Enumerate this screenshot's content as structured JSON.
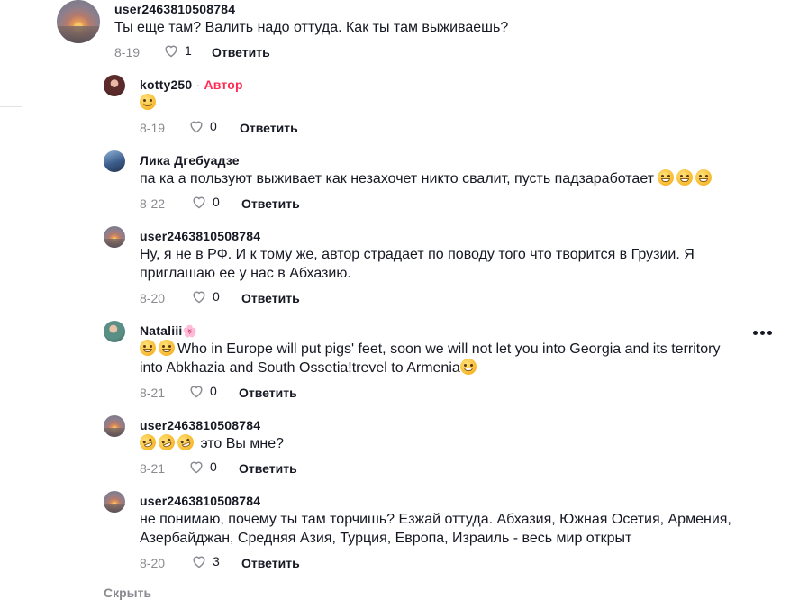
{
  "comments": [
    {
      "username": "user2463810508784",
      "text": "Ты еще там? Валить надо оттуда. Как ты там выживаешь?",
      "date": "8-19",
      "likes": "1",
      "reply_label": "Ответить",
      "avatar": "sunset"
    },
    {
      "username": "kotty250",
      "separator": "·",
      "badge": "Автор",
      "emoji": [
        "slightly-smiling-face"
      ],
      "text": "",
      "date": "8-19",
      "likes": "0",
      "reply_label": "Ответить",
      "avatar": "girl"
    },
    {
      "username": "Лика Дгебуадзе",
      "text": "па ка а пользуют выживает как незахочет никто свалит, пусть падзаработает",
      "emoji_after": [
        "grinning-face",
        "grinning-face",
        "grinning-face"
      ],
      "date": "8-22",
      "likes": "0",
      "reply_label": "Ответить",
      "avatar": "blue"
    },
    {
      "username": "user2463810508784",
      "text": "Ну, я не в РФ. И к тому же, автор страдает по поводу того что творится в Грузии. Я приглашаю ее у нас в Абхазию.",
      "date": "8-20",
      "likes": "0",
      "reply_label": "Ответить",
      "avatar": "sunset"
    },
    {
      "username": "Nataliii",
      "username_emoji": "🌸",
      "emoji_before": [
        "grinning-face",
        "grinning-face"
      ],
      "text": "Who in Europe will put pigs' feet, soon we will not let you into Georgia and its territory into Abkhazia and South Ossetia!trevel to Armenia",
      "emoji_after": [
        "face-with-tears-of-joy"
      ],
      "date": "8-21",
      "likes": "0",
      "reply_label": "Ответить",
      "avatar": "green"
    },
    {
      "username": "user2463810508784",
      "emoji_before": [
        "rolling-on-floor-laughing",
        "rolling-on-floor-laughing",
        "rolling-on-floor-laughing"
      ],
      "text": "это Вы мне?",
      "date": "8-21",
      "likes": "0",
      "reply_label": "Ответить",
      "avatar": "sunset"
    },
    {
      "username": "user2463810508784",
      "text": "не понимаю, почему ты там торчишь? Езжай оттуда. Абхазия, Южная Осетия, Армения, Азербайджан, Средняя Азия, Турция, Европа, Израиль - весь мир открыт",
      "date": "8-20",
      "likes": "3",
      "reply_label": "Ответить",
      "avatar": "sunset"
    }
  ],
  "hide_label": "Скрыть",
  "more_icon": "more-horizontal-icon",
  "colors": {
    "author_badge": "#fe2c55",
    "meta_gray": "#8a8b91",
    "text": "#161823"
  }
}
